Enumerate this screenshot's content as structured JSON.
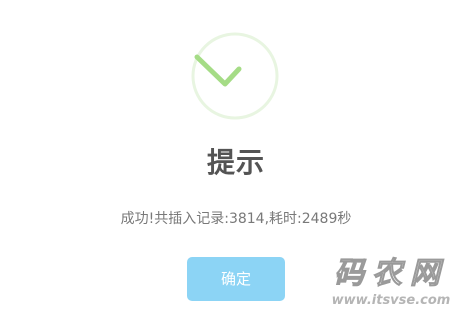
{
  "dialog": {
    "title": "提示",
    "message": "成功!共插入记录:3814,耗时:2489秒",
    "confirm_label": "确定",
    "icon": "success-check-icon"
  },
  "watermark": {
    "main": "码农网",
    "url": "www.itsvse.com"
  },
  "colors": {
    "icon_ring": "#e8f5e1",
    "icon_check": "#a5dc86",
    "button": "#8cd4f5",
    "title_text": "#545454",
    "message_text": "#797979"
  }
}
